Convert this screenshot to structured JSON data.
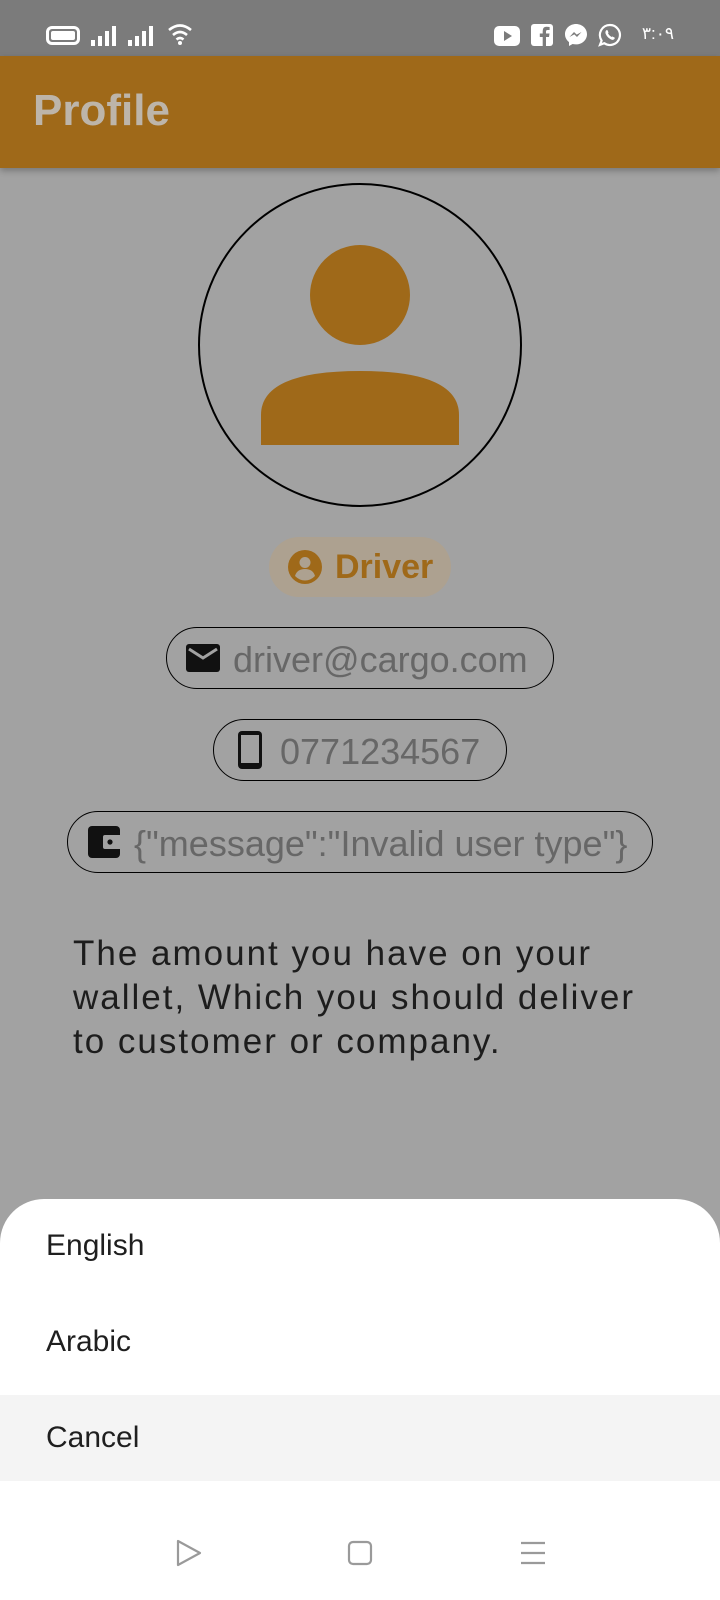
{
  "status_bar": {
    "time": "٣:٠٩",
    "icons": [
      "battery-icon",
      "signal-icon",
      "signal-icon",
      "wifi-icon",
      "youtube-icon",
      "facebook-icon",
      "messenger-icon",
      "whatsapp-icon"
    ]
  },
  "app_bar": {
    "title": "Profile"
  },
  "profile": {
    "avatar_icon": "person-icon",
    "role": "Driver",
    "email": "driver@cargo.com",
    "phone": "0771234567",
    "wallet_value": "{\"message\":\"Invalid user type\"}",
    "wallet_description": "The amount you have on your wallet, Which you should deliver to customer or company."
  },
  "language_sheet": {
    "options": [
      "English",
      "Arabic"
    ],
    "cancel": "Cancel"
  },
  "nav_bar": {
    "icons": [
      "back-icon",
      "home-icon",
      "recents-icon"
    ]
  },
  "colors": {
    "accent": "#9f6919",
    "status_bar": "#7b7b7b",
    "scrim_background": "#a2a2a2",
    "sheet": "#ffffff"
  }
}
